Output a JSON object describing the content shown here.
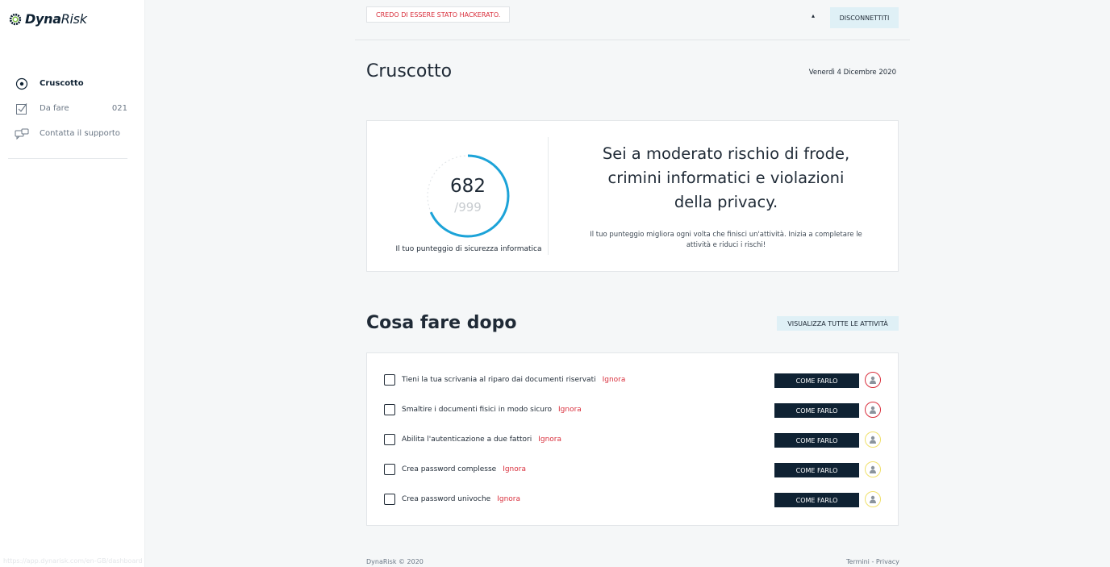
{
  "brand": {
    "name_bold": "Dyna",
    "name_italic": "Risk"
  },
  "sidebar": {
    "items": [
      {
        "label": "Cruscotto",
        "icon": "dashboard-icon",
        "active": true,
        "count": ""
      },
      {
        "label": "Da fare",
        "icon": "checklist-icon",
        "active": false,
        "count": "021"
      },
      {
        "label": "Contatta il supporto",
        "icon": "chat-icon",
        "active": false,
        "count": ""
      }
    ],
    "status_url": "https://app.dynarisk.com/en-GB/dashboard"
  },
  "topbar": {
    "hacked_label": "CREDO DI ESSERE STATO HACKERATO.",
    "caret": "▴",
    "logout_label": "DISCONNETTITI"
  },
  "page": {
    "title": "Cruscotto",
    "date": "Venerdì 4 Dicembre 2020"
  },
  "score": {
    "value": "682",
    "max": "/999",
    "fraction": 0.683,
    "label": "Il tuo punteggio di sicurezza informatica",
    "message_lines": [
      "Sei a moderato rischio di frode,",
      "crimini informatici e violazioni",
      "della privacy."
    ],
    "subtext": "Il tuo punteggio migliora ogni volta che finisci un'attività. Inizia a completare le attività e riduci i rischi!",
    "ring_color": "#1ca3d8"
  },
  "next_steps": {
    "title": "Cosa fare dopo",
    "view_all_label": "VISUALIZZA TUTTE LE ATTIVITÀ",
    "how_label": "COME FARLO",
    "ignore_label": "Ignora",
    "tasks": [
      {
        "label": "Tieni la tua scrivania al riparo dai documenti riservati",
        "priority": "high"
      },
      {
        "label": "Smaltire i documenti fisici in modo sicuro",
        "priority": "high"
      },
      {
        "label": "Abilita l'autenticazione a due fattori",
        "priority": "medium"
      },
      {
        "label": "Crea password complesse",
        "priority": "medium"
      },
      {
        "label": "Crea password univoche",
        "priority": "medium"
      }
    ]
  },
  "colors": {
    "high": "#d9303d",
    "medium": "#f0e06a",
    "accent_dark": "#0f2233",
    "accent_light": "#dff0f6"
  },
  "footer": {
    "copyright": "DynaRisk © 2020",
    "terms": "Termini",
    "separator": "-",
    "privacy": "Privacy"
  }
}
